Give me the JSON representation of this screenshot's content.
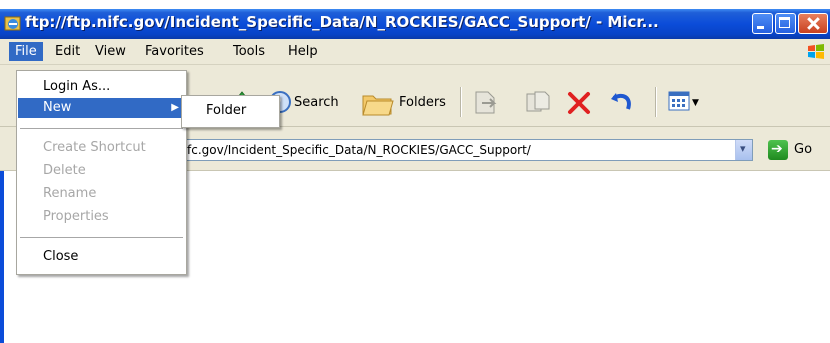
{
  "window": {
    "title": "ftp://ftp.nifc.gov/Incident_Specific_Data/N_ROCKIES/GACC_Support/ - Micr..."
  },
  "menubar": {
    "items": [
      "File",
      "Edit",
      "View",
      "Favorites",
      "Tools",
      "Help"
    ]
  },
  "toolbar": {
    "search_label": "Search",
    "folders_label": "Folders"
  },
  "address": {
    "value": "fc.gov/Incident_Specific_Data/N_ROCKIES/GACC_Support/",
    "go_label": "Go"
  },
  "file_menu": {
    "items": [
      {
        "label": "Login As...",
        "enabled": true
      },
      {
        "label": "New",
        "enabled": true,
        "highlighted": true
      },
      {
        "label": "Create Shortcut",
        "enabled": false
      },
      {
        "label": "Delete",
        "enabled": false
      },
      {
        "label": "Rename",
        "enabled": false
      },
      {
        "label": "Properties",
        "enabled": false
      },
      {
        "label": "Close",
        "enabled": true
      }
    ]
  },
  "new_submenu": {
    "items": [
      "Folder"
    ]
  },
  "colors": {
    "titlebar": "#0b4cd9",
    "menu_highlight": "#316ac5",
    "chrome": "#ece9d8",
    "disabled_text": "#a7a7a7"
  },
  "icons": [
    "ie-app-icon",
    "minimize-icon",
    "maximize-icon",
    "close-icon",
    "windows-logo-icon",
    "up-folder-icon",
    "search-icon",
    "folders-icon",
    "move-to-icon",
    "copy-to-icon",
    "delete-icon",
    "undo-icon",
    "views-icon",
    "dropdown-icon",
    "go-arrow-icon",
    "submenu-arrow-icon"
  ]
}
